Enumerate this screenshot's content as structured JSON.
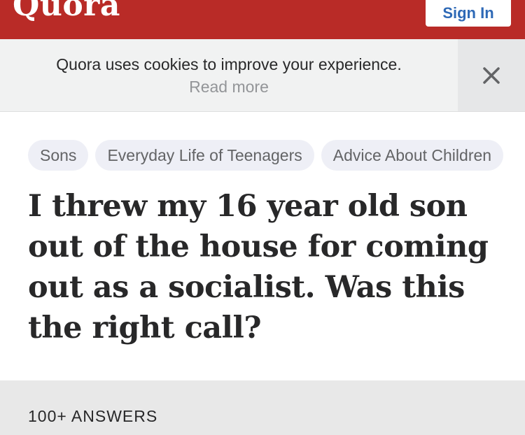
{
  "header": {
    "logo": "Quora",
    "signin_label": "Sign In",
    "brand_color": "#b92b27",
    "link_color": "#2e69b6"
  },
  "cookie_banner": {
    "message": "Quora uses cookies to improve your experience.",
    "link": "Read more",
    "close_icon": "close-icon"
  },
  "topics": [
    {
      "label": "Sons"
    },
    {
      "label": "Everyday Life of Teenagers"
    },
    {
      "label": "Advice About Children"
    }
  ],
  "question": {
    "title": "I threw my 16 year old son out of the house for coming out as a socialist. Was this the right call?"
  },
  "answers": {
    "count_label": "100+ ANSWERS"
  }
}
